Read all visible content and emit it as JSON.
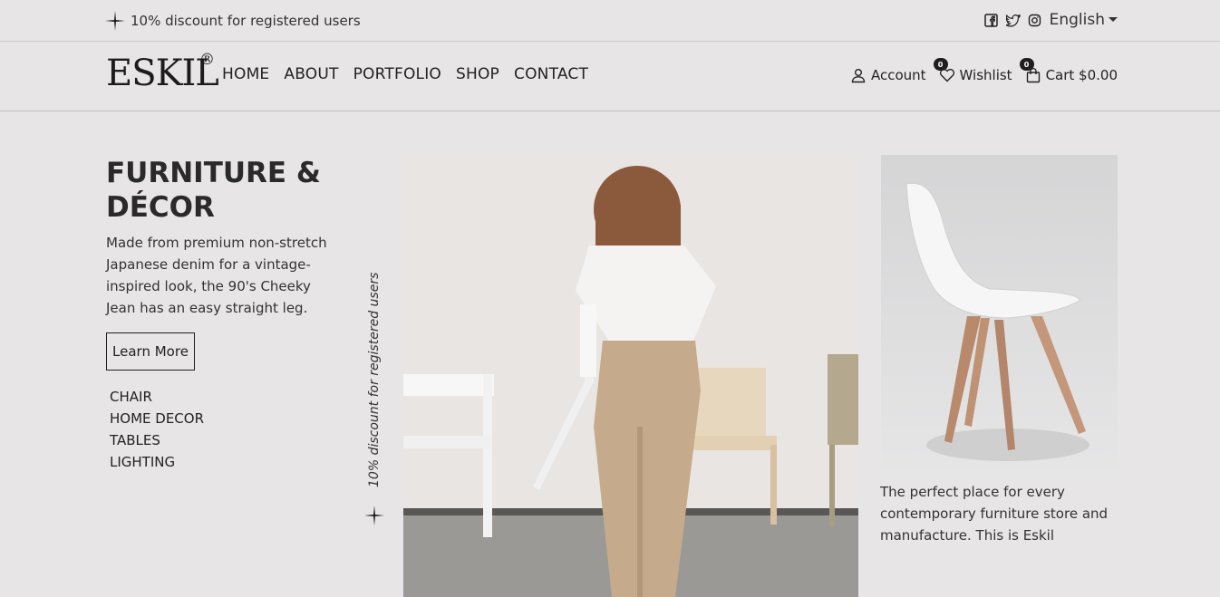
{
  "topbar": {
    "promo_text": "10% discount for registered users",
    "social_icons": [
      "facebook-icon",
      "twitter-icon",
      "instagram-icon"
    ],
    "language": "English"
  },
  "header": {
    "logo": "ESKIL",
    "logo_mark": "®",
    "nav": [
      "HOME",
      "ABOUT",
      "PORTFOLIO",
      "SHOP",
      "CONTACT"
    ],
    "account_label": "Account",
    "wishlist_label": "Wishlist",
    "wishlist_count": "0",
    "cart_label": "Cart $0.00",
    "cart_count": "0"
  },
  "hero": {
    "title": "FURNITURE & DÉCOR",
    "description": "Made from premium non-stretch Japanese denim for a vintage-inspired look, the 90's Cheeky Jean has an easy straight leg.",
    "button_label": "Learn More",
    "categories": [
      "CHAIR",
      "HOME DECOR",
      "TABLES",
      "LIGHTING"
    ],
    "vertical_text": "10% discount for registered users"
  },
  "side": {
    "caption": "The perfect place for every contemporary furniture store and manufacture. This is Eskil"
  },
  "colors": {
    "background": "#e7e5e6",
    "text": "#222222",
    "badge": "#1f1f1f"
  }
}
